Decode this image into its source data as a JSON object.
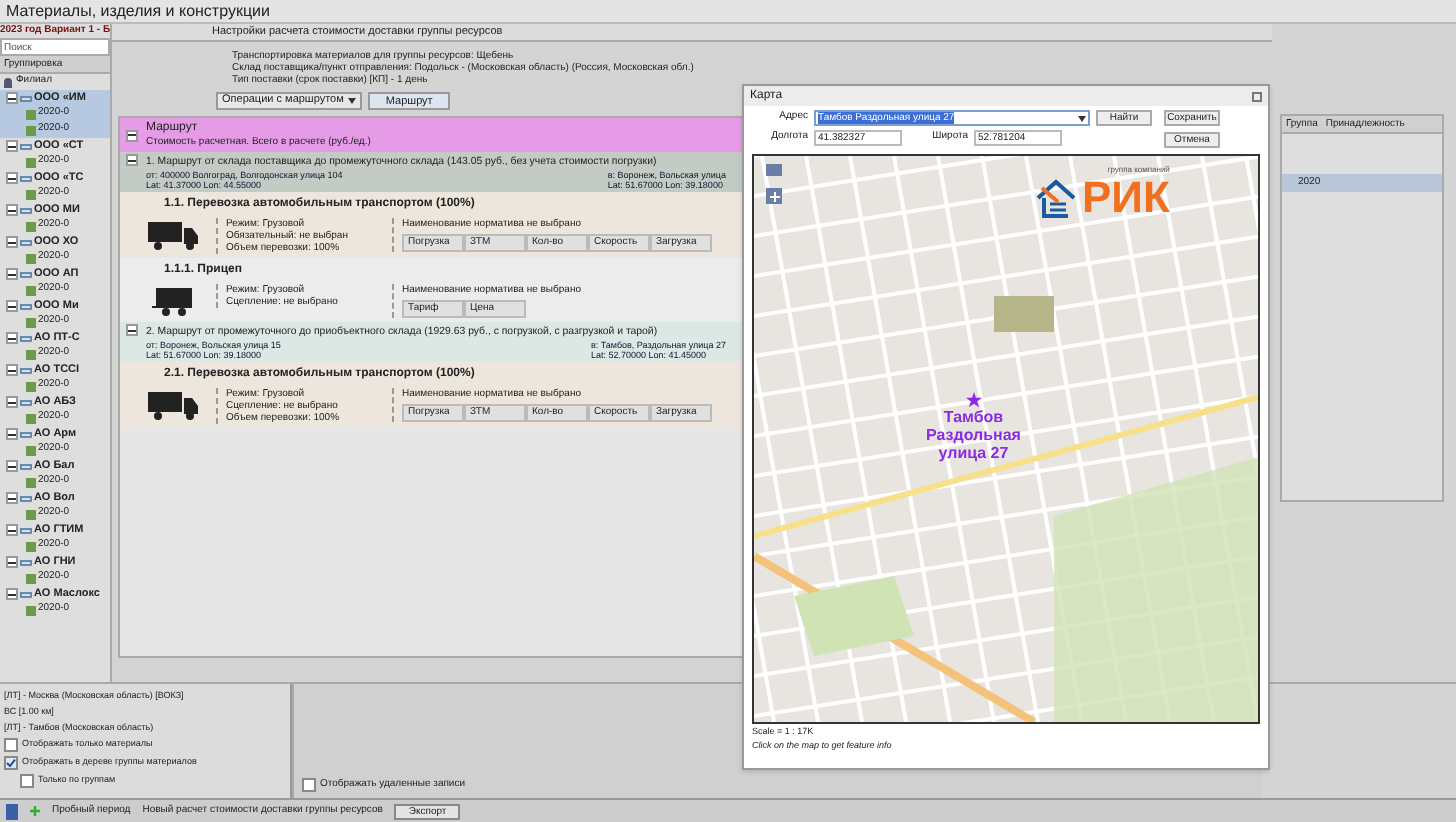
{
  "window": {
    "title": "Материалы, изделия и конструкции"
  },
  "variant": "2023 год Вариант 1 - Б",
  "settings_tab": "Настройки расчета стоимости доставки группы ресурсов",
  "sidebar": {
    "search_label": "Поиск",
    "group_label": "Группировка",
    "root": "Филиал",
    "items": [
      {
        "name": "ООО «ИМ",
        "expanded": true,
        "selected": true,
        "children": [
          "2020-0",
          "2020-0"
        ]
      },
      {
        "name": "ООО «СТ",
        "expanded": true,
        "selected": false,
        "children": [
          "2020-0"
        ]
      },
      {
        "name": "ООО «ТС",
        "expanded": true,
        "selected": false,
        "children": [
          "2020-0"
        ]
      },
      {
        "name": "ООО МИ",
        "expanded": true,
        "selected": false,
        "children": [
          "2020-0"
        ]
      },
      {
        "name": "ООО ХО",
        "expanded": true,
        "selected": false,
        "children": [
          "2020-0"
        ]
      },
      {
        "name": "ООО АП",
        "expanded": true,
        "selected": false,
        "children": [
          "2020-0"
        ]
      },
      {
        "name": "ООО Ми",
        "expanded": true,
        "selected": false,
        "children": [
          "2020-0"
        ]
      },
      {
        "name": "АО ПТ-С",
        "expanded": true,
        "selected": false,
        "children": [
          "2020-0"
        ]
      },
      {
        "name": "АО ТССІ",
        "expanded": true,
        "selected": false,
        "children": [
          "2020-0"
        ]
      },
      {
        "name": "АО АБЗ",
        "expanded": true,
        "selected": false,
        "children": [
          "2020-0"
        ]
      },
      {
        "name": "АО Арм",
        "expanded": true,
        "selected": false,
        "children": [
          "2020-0"
        ]
      },
      {
        "name": "АО Бал",
        "expanded": true,
        "selected": false,
        "children": [
          "2020-0"
        ]
      },
      {
        "name": "АО Вол",
        "expanded": true,
        "selected": false,
        "children": [
          "2020-0"
        ]
      },
      {
        "name": "АО ГТИМ",
        "expanded": true,
        "selected": false,
        "children": [
          "2020-0"
        ]
      },
      {
        "name": "АО ГНИ",
        "expanded": true,
        "selected": false,
        "children": [
          "2020-0"
        ]
      },
      {
        "name": "АО Маслокс",
        "expanded": true,
        "selected": false,
        "children": [
          "2020-0"
        ]
      }
    ],
    "options": [
      {
        "label": "Отображать только материалы",
        "checked": false
      },
      {
        "label": "Отображать в дереве группы материалов",
        "checked": true
      },
      {
        "label": "Только по группам",
        "checked": false
      }
    ]
  },
  "header_lines": [
    "Транспортировка материалов для группы ресурсов: Щебень",
    "Склад поставщика/пункт отправления: Подольск - (Московская область) (Россия, Московская обл.)",
    "Тип поставки (срок поставки) [КП] - 1 день"
  ],
  "buttons": {
    "operations": "Операции с маршрутом",
    "route": "Маршрут"
  },
  "route": {
    "title": "Маршрут",
    "subtitle": "Стоимость расчетная. Всего в расчете (руб./ед.)",
    "expanded": true,
    "legs": [
      {
        "title": "1. Маршрут от склада поставщика до промежуточного склада (143.05 руб., без учета стоимости погрузки)",
        "expanded": true,
        "from": "от: 400000 Волгоград, Волгодонская улица 104",
        "from_coords": "Lat: 41.37000 Lon: 44.55000",
        "to": "в: Воронеж, Вольская улица",
        "to_coords": "Lat: 51.67000 Lon: 39.18000",
        "segments": [
          {
            "title": "1.1. Перевозка автомобильным транспортом (100%)",
            "kind": "truck",
            "details": [
              "Режим: Грузовой",
              "Обязательный: не выбран",
              "Объем перевозки: 100%"
            ],
            "table_title": "Наименование норматива не выбрано",
            "columns": [
              "Погрузка",
              "ЗТМ",
              "Кол-во",
              "Скорость",
              "Загрузка"
            ]
          },
          {
            "title": "1.1.1. Прицеп",
            "kind": "trailer",
            "details": [
              "Режим: Грузовой",
              "Сцепление: не выбрано"
            ],
            "table_title": "Наименование норматива не выбрано",
            "columns": [
              "Тариф",
              "Цена"
            ]
          }
        ]
      },
      {
        "title": "2. Маршрут от промежуточного до приобъектного склада (1929.63 руб., с погрузкой, с разгрузкой и тарой)",
        "expanded": true,
        "from": "от: Воронеж, Вольская улица 15",
        "from_coords": "Lat: 51.67000 Lon: 39.18000",
        "to": "в: Тамбов, Раздольная улица 27",
        "to_coords": "Lat: 52.70000 Lon: 41.45000",
        "segments": [
          {
            "title": "2.1. Перевозка автомобильным транспортом (100%)",
            "kind": "truck",
            "details": [
              "Режим: Грузовой",
              "Сцепление: не выбрано",
              "Объем перевозки: 100%"
            ],
            "table_title": "Наименование норматива не выбрано",
            "columns": [
              "Погрузка",
              "ЗТМ",
              "Кол-во",
              "Скорость",
              "Загрузка"
            ]
          }
        ]
      }
    ]
  },
  "lower_list": [
    "[ЛТ] - Москва (Московская область) [ВОКЗ]",
    "ВС [1.00 км]",
    "[ЛТ] - Тамбов (Московская область)"
  ],
  "deleted_option": {
    "label": "Отображать удаленные записи",
    "checked": false
  },
  "right_panel": {
    "columns": [
      "Группа",
      "Принадлежность"
    ],
    "rows": [
      {
        "text": "2020",
        "selected": true
      }
    ]
  },
  "dialog": {
    "title": "Карта",
    "address_label": "Адрес",
    "address": "Тамбов Раздольная улица 27",
    "find": "Найти",
    "save": "Сохранить",
    "lon_label": "Долгота",
    "lon": "41.382327",
    "lat_label": "Широта",
    "lat": "52.781204",
    "cancel": "Отмена",
    "marker_label": "Тамбов\nРаздольная\nулица 27",
    "logo_text": "РИК",
    "logo_caption": "группа компаний",
    "scale": "Scale = 1 : 17K",
    "hint": "Click on the map to get feature info"
  },
  "status_bar": {
    "trial": "Пробный период",
    "message": "Новый расчет стоимости доставки группы ресурсов",
    "export": "Экспорт"
  }
}
